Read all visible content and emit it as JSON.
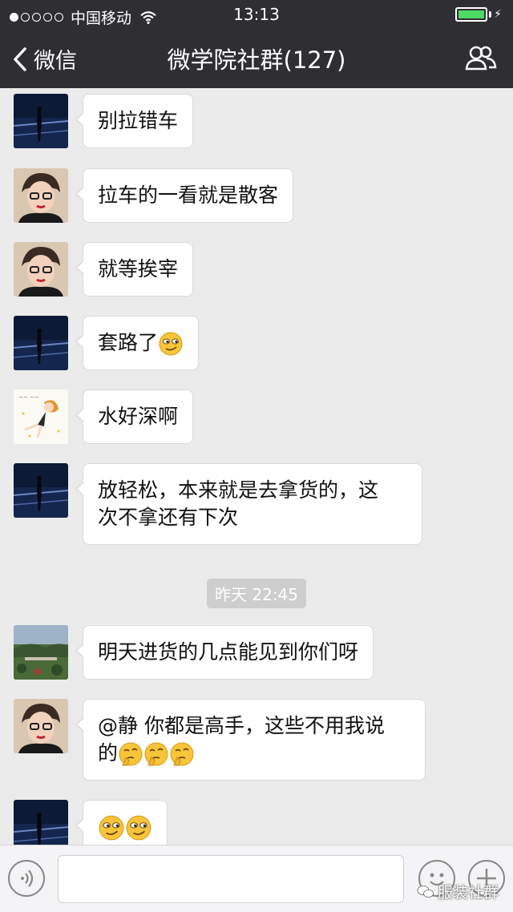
{
  "status": {
    "carrier": "中国移动",
    "time": "13:13"
  },
  "nav": {
    "back_label": "微信",
    "title": "微学院社群(127)"
  },
  "messages": [
    {
      "text": "别拉错车",
      "avatar": "night-sea-avatar"
    },
    {
      "text": "拉车的一看就是散客",
      "avatar": "glasses-woman-avatar"
    },
    {
      "text": "就等挨宰",
      "avatar": "glasses-woman-avatar"
    },
    {
      "text": "套路了",
      "avatar": "night-sea-avatar",
      "emoji": "smirk-emoji"
    },
    {
      "text": "水好深啊",
      "avatar": "cartoon-girl-avatar"
    },
    {
      "line1": "放轻松，本来就是去拿货的，这",
      "line2": "次不拿还有下次",
      "avatar": "night-sea-avatar"
    },
    {
      "text": "明天进货的几点能见到你们呀",
      "avatar": "garden-avatar"
    },
    {
      "line1": "@静 你都是高手，这些不用我说",
      "line2": "的",
      "avatar": "glasses-woman-avatar",
      "emoji": "thinking-emoji"
    },
    {
      "text": "",
      "avatar": "night-sea-avatar",
      "emoji": "smirk-emoji"
    }
  ],
  "timestamp": "昨天 22:45",
  "watermark": "服装社群",
  "colors": {
    "nav_bg": "#2f2f33",
    "chat_bg": "#ebebeb",
    "battery": "#4cd964"
  }
}
